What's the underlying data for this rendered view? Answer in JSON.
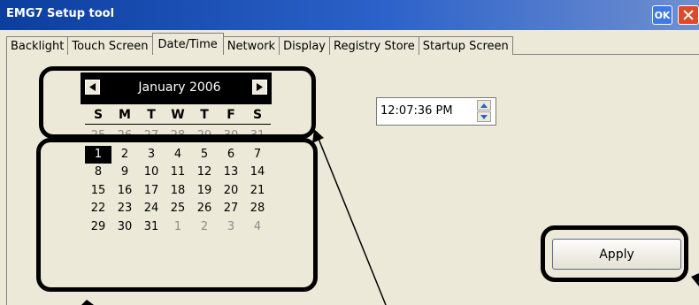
{
  "window": {
    "title": "EMG7 Setup tool",
    "ok_label": "OK",
    "close_icon": "close-icon"
  },
  "tabs": [
    {
      "label": "Backlight",
      "active": false
    },
    {
      "label": "Touch Screen",
      "active": false
    },
    {
      "label": "Date/Time",
      "active": true
    },
    {
      "label": "Network",
      "active": false
    },
    {
      "label": "Display",
      "active": false
    },
    {
      "label": "Registry Store",
      "active": false
    },
    {
      "label": "Startup Screen",
      "active": false
    }
  ],
  "calendar": {
    "month_label": "January 2006",
    "prev_icon": "triangle-left-icon",
    "next_icon": "triangle-right-icon",
    "weekdays": [
      "S",
      "M",
      "T",
      "W",
      "T",
      "F",
      "S"
    ],
    "weeks": [
      [
        {
          "d": "25",
          "other": true
        },
        {
          "d": "26",
          "other": true
        },
        {
          "d": "27",
          "other": true
        },
        {
          "d": "28",
          "other": true
        },
        {
          "d": "29",
          "other": true
        },
        {
          "d": "30",
          "other": true
        },
        {
          "d": "31",
          "other": true
        }
      ],
      [
        {
          "d": "1",
          "selected": true
        },
        {
          "d": "2"
        },
        {
          "d": "3"
        },
        {
          "d": "4"
        },
        {
          "d": "5"
        },
        {
          "d": "6"
        },
        {
          "d": "7"
        }
      ],
      [
        {
          "d": "8"
        },
        {
          "d": "9"
        },
        {
          "d": "10"
        },
        {
          "d": "11"
        },
        {
          "d": "12"
        },
        {
          "d": "13"
        },
        {
          "d": "14"
        }
      ],
      [
        {
          "d": "15"
        },
        {
          "d": "16"
        },
        {
          "d": "17"
        },
        {
          "d": "18"
        },
        {
          "d": "19"
        },
        {
          "d": "20"
        },
        {
          "d": "21"
        }
      ],
      [
        {
          "d": "22"
        },
        {
          "d": "23"
        },
        {
          "d": "24"
        },
        {
          "d": "25"
        },
        {
          "d": "26"
        },
        {
          "d": "27"
        },
        {
          "d": "28"
        }
      ],
      [
        {
          "d": "29"
        },
        {
          "d": "30"
        },
        {
          "d": "31"
        },
        {
          "d": "1",
          "other": true
        },
        {
          "d": "2",
          "other": true
        },
        {
          "d": "3",
          "other": true
        },
        {
          "d": "4",
          "other": true
        }
      ]
    ]
  },
  "time": {
    "value": "12:07:36 PM",
    "spin_up_icon": "spin-up-icon",
    "spin_down_icon": "spin-down-icon"
  },
  "apply_label": "Apply",
  "colors": {
    "titlebar": "#0b3e9e",
    "window_bg": "#ece9d8",
    "callout": "#000000",
    "close_button": "#dc4a2a"
  }
}
